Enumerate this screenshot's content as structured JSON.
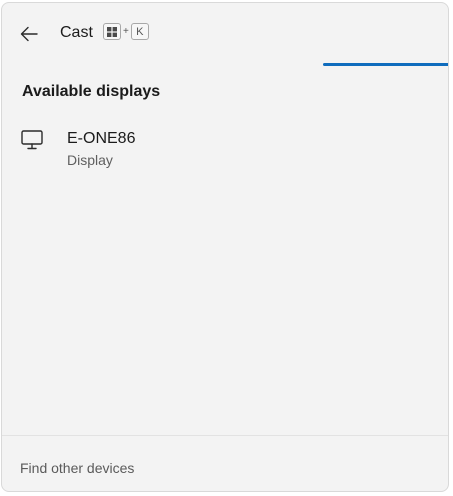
{
  "header": {
    "title": "Cast",
    "shortcut": {
      "win_key_icon": "windows-logo-icon",
      "plus": "+",
      "key": "K"
    }
  },
  "progress": {
    "state": "indeterminate",
    "color": "#0f6cbd"
  },
  "section": {
    "title": "Available displays"
  },
  "displays": [
    {
      "name": "E-ONE86",
      "type": "Display",
      "icon": "monitor-icon"
    }
  ],
  "footer": {
    "link_label": "Find other devices"
  }
}
